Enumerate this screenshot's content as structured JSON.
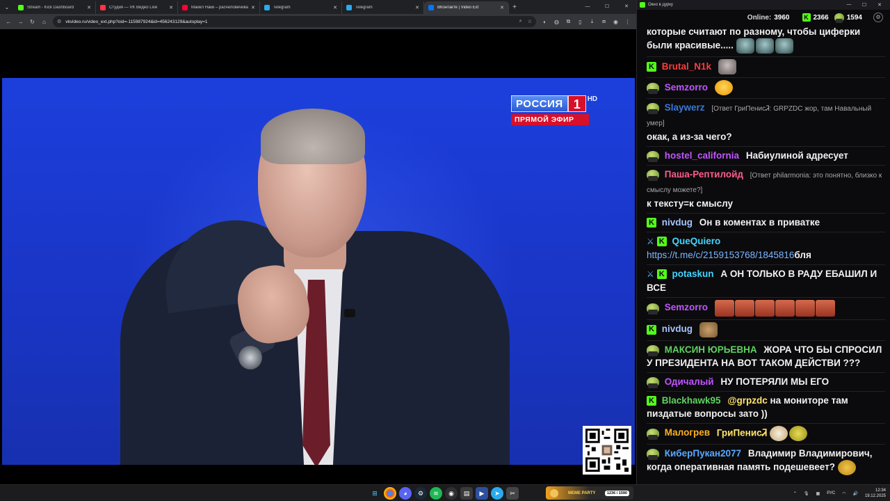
{
  "browser": {
    "tabs": [
      {
        "title": "Stream - Kick Dashboard",
        "color": "#53fc18",
        "active": false
      },
      {
        "title": "Студия — VK Видео Live",
        "color": "#ff3347",
        "active": false
      },
      {
        "title": "Майкл Наки – расчеловечива",
        "color": "#ff0033",
        "active": false
      },
      {
        "title": "Telegram",
        "color": "#2aabee",
        "active": false
      },
      {
        "title": "Telegram",
        "color": "#2aabee",
        "active": false
      },
      {
        "title": "ВКонтакте | Video Ext",
        "color": "#0077ff",
        "active": true
      }
    ],
    "url": "vkvideo.ru/video_ext.php?oid=-115987924&id=456243129&autoplay=1"
  },
  "video": {
    "channel_name": "РОССИЯ",
    "channel_number": "1",
    "hd_label": "HD",
    "live_label": "ПРЯМОЙ ЭФИР"
  },
  "chat_window": {
    "title": "Окно в дурку",
    "online_label": "Online:",
    "online_count": "3960",
    "kick_count": "2366",
    "vk_count": "1594"
  },
  "chat_messages": [
    {
      "id": "m0",
      "user": "",
      "color": "#ffffff",
      "text": "которые считают по разному, чтобы циферки были красивые.....",
      "emotes": [
        "pepe-e",
        "pepe-e",
        "pepe-e"
      ]
    },
    {
      "id": "m1",
      "user": "Brutal_N1k",
      "color": "#ff3b3b",
      "badge": "kick",
      "text": "",
      "emotes": [
        "rat"
      ]
    },
    {
      "id": "m2",
      "user": "Semzorro",
      "color": "#c056ff",
      "badge": "vk",
      "text": "",
      "emotes": [
        "laugh"
      ]
    },
    {
      "id": "m3",
      "user": "Slaywerz",
      "color": "#3a78d6",
      "badge": "vk",
      "reply": "[Ответ ГриПенисᏘ: GRPZDC жор, там Навальный умер]",
      "text": "окак, а из-за чего?"
    },
    {
      "id": "m4",
      "user": "hostel_california",
      "color": "#c056ff",
      "badge": "vk",
      "text": "Набиулиной адресует"
    },
    {
      "id": "m5",
      "user": "Паша-Рептилойд",
      "color": "#ff5c8a",
      "badge": "vk",
      "reply": "[Ответ philarmonia: это понятно, близко к смыслу можете?]",
      "text": "к тексту=к смыслу"
    },
    {
      "id": "m6",
      "user": "nivdug",
      "color": "#a7c4ff",
      "badge": "kick",
      "text": "Он в коментах в приватке"
    },
    {
      "id": "m7",
      "user": "QueQuiero",
      "color": "#44d4ff",
      "badge": "kick-mod",
      "link": "https://t.me/c/2159153768/1845816",
      "text": "бля"
    },
    {
      "id": "m8",
      "user": "potaskun",
      "color": "#44d4ff",
      "badge": "kick-mod",
      "text": "А ОН ТОЛЬКО В РАДУ ЕБАШИЛ И ВСЕ"
    },
    {
      "id": "m9",
      "user": "Semzorro",
      "color": "#c056ff",
      "badge": "vk",
      "text": "",
      "emotes": [
        "face",
        "face",
        "face",
        "face",
        "face",
        "face"
      ]
    },
    {
      "id": "m10",
      "user": "nivdug",
      "color": "#a7c4ff",
      "badge": "kick",
      "text": "",
      "emotes": [
        "cat"
      ]
    },
    {
      "id": "m11",
      "user": "МАКСИН ЮРЬЕВНА",
      "color": "#5fd35f",
      "badge": "vk",
      "text": "ЖОРА ЧТО БЫ СПРОСИЛ У ПРЕЗИДЕНТА НА ВОТ ТАКОМ ДЕЙСТВИ ???"
    },
    {
      "id": "m12",
      "user": "Одичалый",
      "color": "#c056ff",
      "badge": "vk",
      "text": "НУ ПОТЕРЯЛИ МЫ ЕГО"
    },
    {
      "id": "m13",
      "user": "Blackhawk95",
      "color": "#5fd35f",
      "badge": "kick",
      "mention": "@grpzdc",
      "text": "на мониторе там пиздатые вопросы зато ))"
    },
    {
      "id": "m14",
      "user": "Малогрев",
      "color": "#ffb020",
      "badge": "vk",
      "mention": "ГриПенисᏘ",
      "text": "",
      "emotes": [
        "chick",
        "pepe2"
      ]
    },
    {
      "id": "m15",
      "user": "КиберПукан2077",
      "color": "#5aa8ff",
      "badge": "vk",
      "text": "Владимир Владимирович, когда оперативная память подешевеет?",
      "emotes": [
        "smirk"
      ]
    }
  ],
  "taskbar": {
    "widget_text": "MEME PARTY",
    "widget_badge": "1236 / 1590",
    "lang": "РУС",
    "time": "12:34",
    "date": "19.12.2025"
  }
}
